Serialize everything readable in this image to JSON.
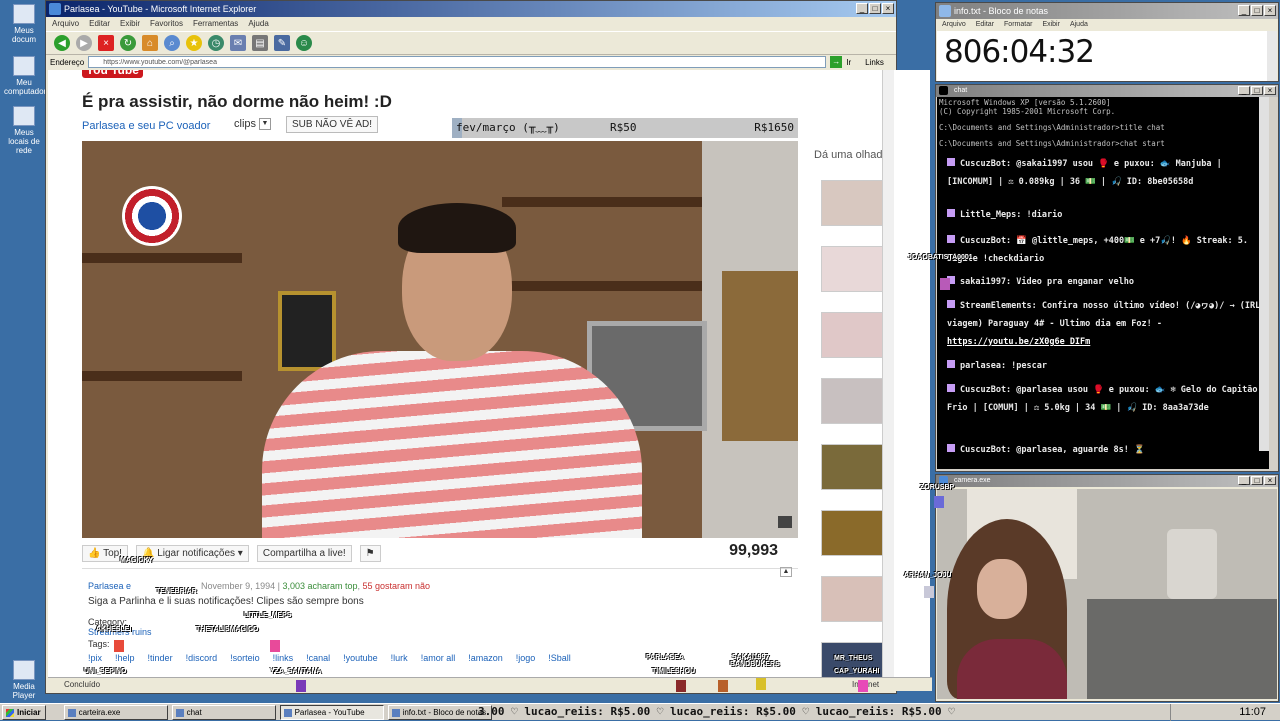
{
  "desktop": {
    "icons": [
      {
        "label": "Meus docum"
      },
      {
        "label": "Meu computador"
      },
      {
        "label": "Meus locais de rede"
      },
      {
        "label": "Media Player"
      }
    ]
  },
  "ie": {
    "title": "Parlasea - YouTube - Microsoft Internet Explorer",
    "menu": [
      "Arquivo",
      "Editar",
      "Exibir",
      "Favoritos",
      "Ferramentas",
      "Ajuda"
    ],
    "address_label": "Endereço",
    "address_url": "https://www.youtube.com/@parlasea",
    "go_label": "Ir",
    "links_label": "Links",
    "status_left": "Concluído",
    "status_right": "Internet"
  },
  "youtube": {
    "video_title": "É pra assistir, não dorme não heim! :D",
    "channel": "Parlasea e seu PC voador",
    "clips_label": "clips",
    "sub_button": "SUB NÃO VÊ AD!",
    "goal": {
      "label": "fev/março (╥﹏╥)",
      "current": "R$50",
      "target": "R$1650",
      "progress": 0.03
    },
    "actions": {
      "top": "Top!",
      "notify": "Ligar notificações",
      "share": "Compartilha a live!"
    },
    "views": "99,993",
    "desc": {
      "channel": "Parlasea e",
      "date": "November 9, 1994",
      "likes": "3,003 acharam top",
      "dislikes": "55 gostaram não",
      "line": "Siga a Parlinha e li     suas notificações! Clipes são sempre bons",
      "category_label": "Category:",
      "category_value": "Streamers ruins",
      "tags_label": "Tags:",
      "tags": [
        "!pix",
        "!help",
        "!tinder",
        "!discord",
        "!sorteio",
        "!links",
        "!canal",
        "!youtube",
        "!lurk",
        "!amor all",
        "!amazon",
        "!jogo",
        "!Sball"
      ]
    },
    "side_label": "Dá uma olhada",
    "thumb_count": 8
  },
  "notepad": {
    "title": "info.txt - Bloco de notas",
    "menu": [
      "Arquivo",
      "Editar",
      "Formatar",
      "Exibir",
      "Ajuda"
    ],
    "timer": "806:04:32"
  },
  "cmd": {
    "title": "chat",
    "header_lines": [
      "Microsoft Windows XP [versão 5.1.2600]",
      "(C) Copyright 1985-2001 Microsoft Corp.",
      "C:\\Documents and Settings\\Administrador>title chat",
      "C:\\Documents and Settings\\Administrador>chat start"
    ],
    "messages": [
      {
        "text": "CuscuzBot: @sakai1997 usou 🥊 e puxou: 🐟 Manjuba | [INCOMUM] | ⚖ 0.089kg | 36 💵 | 🎣 ID: 8be05658d"
      },
      {
        "text": "Little_Meps: !diario"
      },
      {
        "text": "CuscuzBot: 📅 @little_meps, +400💵 e +7🎣! 🔥 Streak: 5. Digite !checkdiario"
      },
      {
        "text": "sakai1997: Video pra enganar velho"
      },
      {
        "text": "StreamElements: Confira nosso último vídeo! (/◕ヮ◕)/ → (IRL viagem) Paraguay 4# - Ultimo dia em Foz! - "
      },
      {
        "text": "parlasea: !pescar"
      },
      {
        "text": "CuscuzBot: @parlasea usou 🥊 e puxou: 🐟 ❄ Gelo do Capitão Frio | [COMUM] | ⚖ 5.0kg | 34 💵 | 🎣 ID: 8aa3a73de"
      },
      {
        "text": "CuscuzBot: @parlasea, aguarde 8s! ⏳"
      }
    ],
    "link": "https://youtu.be/zX0g6e_DIFm"
  },
  "camera": {
    "title": "camera.exe"
  },
  "taskbar": {
    "start": "Iniciar",
    "tasks": [
      "carteira.exe",
      "chat",
      "Parlasea - YouTube",
      "info.txt - Bloco de notas"
    ],
    "active_task": 2,
    "ticker": "3.00 ♡ lucao_reiis: R$5.00 ♡ lucao_reiis: R$5.00 ♡ lucao_reiis: R$5.00 ♡",
    "clock": "11:07"
  },
  "overlay_names": [
    "MAGICKY",
    "TENEBRIAR",
    "AKHESLEI",
    "THETALISMAGICO",
    "LITTLE_MEPS",
    "UNI_SEPINO",
    "YZA_SANTANA",
    "PARLASEA",
    "TIMILESHOU",
    "SAKAI1997",
    "BANDBUKERS",
    "MR_THEUS",
    "CAP_YURAHI",
    "JOAOBATISTA0001",
    "ZORUSBP",
    "ARHAN_JOJU"
  ]
}
